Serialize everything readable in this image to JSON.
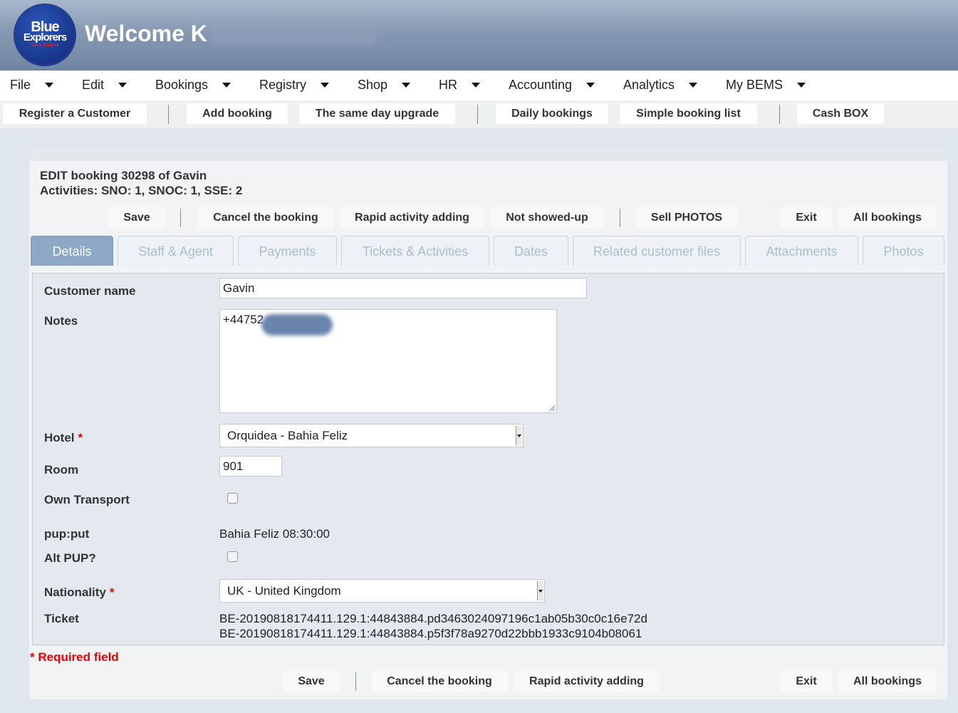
{
  "header": {
    "logo_line1": "Blue",
    "logo_line2": "Explorers",
    "logo_line3": "Gran Canaria",
    "welcome": "Welcome K"
  },
  "menu": [
    {
      "label": "File"
    },
    {
      "label": "Edit"
    },
    {
      "label": "Bookings"
    },
    {
      "label": "Registry"
    },
    {
      "label": "Shop"
    },
    {
      "label": "HR"
    },
    {
      "label": "Accounting"
    },
    {
      "label": "Analytics"
    },
    {
      "label": "My BEMS"
    }
  ],
  "quickbar": {
    "register_customer": "Register a Customer",
    "add_booking": "Add booking",
    "same_day_upgrade": "The same day upgrade",
    "daily_bookings": "Daily bookings",
    "simple_booking_list": "Simple booking list",
    "cash_box": "Cash BOX"
  },
  "booking": {
    "title": "EDIT booking 30298 of Gavin",
    "activities": "Activities: SNO: 1, SNOC: 1, SSE: 2"
  },
  "actions_top": {
    "save": "Save",
    "cancel": "Cancel the booking",
    "rapid": "Rapid activity adding",
    "not_showed": "Not showed-up",
    "sell_photos": "Sell PHOTOS",
    "exit": "Exit",
    "all_bookings": "All bookings"
  },
  "tabs": [
    {
      "label": "Details"
    },
    {
      "label": "Staff & Agent"
    },
    {
      "label": "Payments"
    },
    {
      "label": "Tickets & Activities"
    },
    {
      "label": "Dates"
    },
    {
      "label": "Related customer files"
    },
    {
      "label": "Attachments"
    },
    {
      "label": "Photos"
    }
  ],
  "form": {
    "customer_name_label": "Customer name",
    "customer_name_value": "Gavin",
    "notes_label": "Notes",
    "notes_value": "+44752",
    "hotel_label": "Hotel",
    "hotel_value": "Orquidea - Bahia Feliz",
    "room_label": "Room",
    "room_value": "901",
    "own_transport_label": "Own Transport",
    "pup_label": "pup:put",
    "pup_value": "Bahia Feliz 08:30:00",
    "alt_pup_label": "Alt PUP?",
    "nationality_label": "Nationality",
    "nationality_value": "UK - United Kingdom",
    "ticket_label": "Ticket",
    "ticket_line1": "BE-20190818174411.129.1:44843884.pd3463024097196c1ab05b30c0c16e72d",
    "ticket_line2": "BE-20190818174411.129.1:44843884.p5f3f78a9270d22bbb1933c9104b08061",
    "required_star": "*",
    "required_note": "* Required field"
  },
  "actions_bottom": {
    "save": "Save",
    "cancel": "Cancel the booking",
    "rapid": "Rapid activity adding",
    "exit": "Exit",
    "all_bookings": "All bookings"
  }
}
